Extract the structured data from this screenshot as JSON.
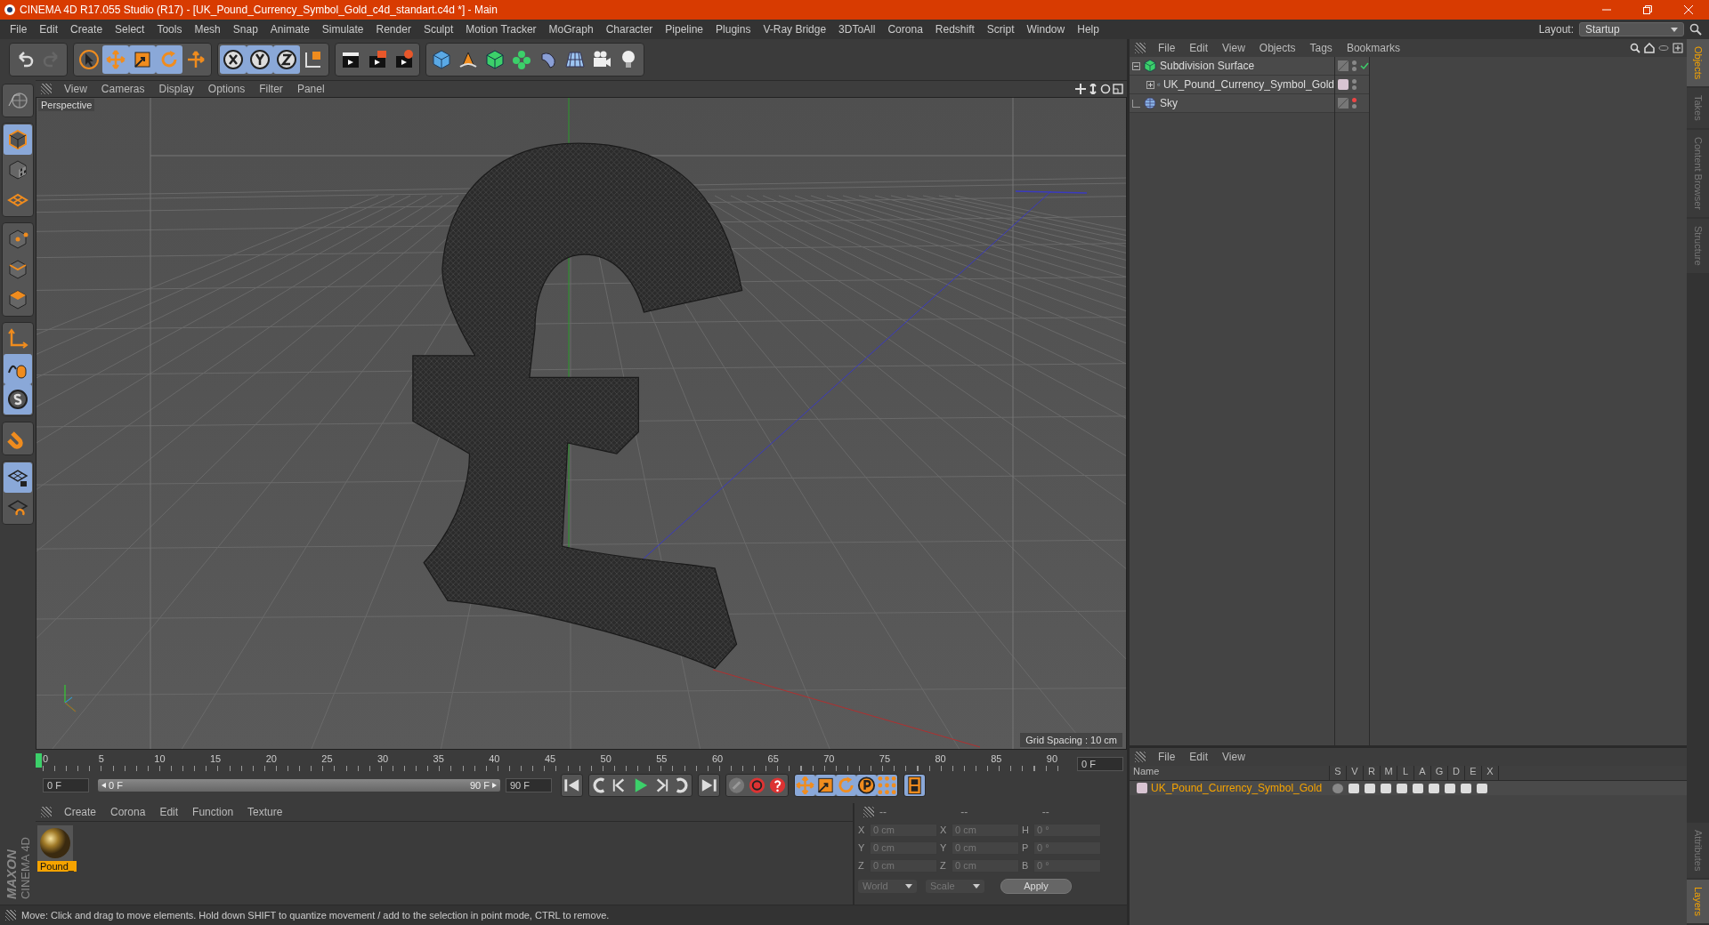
{
  "window": {
    "title": "CINEMA 4D R17.055 Studio (R17) - [UK_Pound_Currency_Symbol_Gold_c4d_standart.c4d *] - Main"
  },
  "menu_bar": [
    "File",
    "Edit",
    "Create",
    "Select",
    "Tools",
    "Mesh",
    "Snap",
    "Animate",
    "Simulate",
    "Render",
    "Sculpt",
    "Motion Tracker",
    "MoGraph",
    "Character",
    "Pipeline",
    "Plugins",
    "V-Ray Bridge",
    "3DToAll",
    "Corona",
    "Redshift",
    "Script",
    "Window",
    "Help"
  ],
  "layout": {
    "label": "Layout:",
    "value": "Startup"
  },
  "toolbar": [
    {
      "items": [
        {
          "kind": "undo",
          "disabled": false
        },
        {
          "kind": "redo",
          "disabled": true
        }
      ]
    },
    {
      "items": [
        {
          "kind": "pointer",
          "selected": false
        },
        {
          "kind": "move",
          "selected": true
        },
        {
          "kind": "scale",
          "selected": true
        },
        {
          "kind": "rotate",
          "selected": true
        },
        {
          "kind": "transform",
          "selected": false
        }
      ]
    },
    {
      "items": [
        {
          "kind": "x",
          "selected": true
        },
        {
          "kind": "y",
          "selected": true
        },
        {
          "kind": "z",
          "selected": true
        },
        {
          "kind": "coords",
          "selected": false
        }
      ]
    },
    {
      "items": [
        {
          "kind": "render-view",
          "selected": false
        },
        {
          "kind": "render-picture",
          "selected": false
        },
        {
          "kind": "render-settings",
          "selected": false
        }
      ]
    },
    {
      "items": [
        {
          "kind": "cube",
          "selected": false
        },
        {
          "kind": "pen",
          "selected": false
        },
        {
          "kind": "subdiv",
          "selected": false
        },
        {
          "kind": "cloner",
          "selected": false
        },
        {
          "kind": "deformer",
          "selected": false
        },
        {
          "kind": "floor",
          "selected": false
        },
        {
          "kind": "camera",
          "selected": false
        },
        {
          "kind": "light",
          "selected": false
        }
      ]
    }
  ],
  "left_toolbar": [
    {
      "items": [
        {
          "kind": "globe",
          "selected": false
        }
      ]
    },
    {
      "items": [
        {
          "kind": "model",
          "selected": true
        },
        {
          "kind": "texture",
          "selected": false
        },
        {
          "kind": "workplane",
          "selected": false
        }
      ]
    },
    {
      "items": [
        {
          "kind": "points",
          "selected": false
        },
        {
          "kind": "edges",
          "selected": false
        },
        {
          "kind": "polygons",
          "selected": false
        }
      ]
    },
    {
      "items": [
        {
          "kind": "axis",
          "selected": false
        },
        {
          "kind": "tweak",
          "selected": true
        },
        {
          "kind": "snap",
          "selected": true
        }
      ]
    },
    {
      "items": [
        {
          "kind": "magnet",
          "selected": false
        }
      ]
    },
    {
      "items": [
        {
          "kind": "gridlock",
          "selected": true
        },
        {
          "kind": "gridrot",
          "selected": false
        }
      ]
    }
  ],
  "logo": {
    "line_1": "MAXON",
    "line_2": "CINEMA 4D"
  },
  "viewport": {
    "menu": [
      "View",
      "Cameras",
      "Display",
      "Options",
      "Filter",
      "Panel"
    ],
    "camera_label": "Perspective",
    "grid_spacing": "Grid Spacing : 10 cm"
  },
  "timeline": {
    "ticks": [
      "0",
      "5",
      "10",
      "15",
      "20",
      "25",
      "30",
      "35",
      "40",
      "45",
      "50",
      "55",
      "60",
      "65",
      "70",
      "75",
      "80",
      "85",
      "90"
    ],
    "playhead": {
      "level": 0
    },
    "current_frame": "0 F",
    "start": "0 F",
    "range": {
      "level": 1
    },
    "range_start": "0 F",
    "range_end": "90 F",
    "end": "90 F",
    "controls": [
      {
        "kind": "first",
        "selected": false
      },
      {
        "kind": "prevkey",
        "selected": false
      },
      {
        "kind": "prevframe",
        "selected": false
      },
      {
        "kind": "play",
        "selected": false
      },
      {
        "kind": "nextframe",
        "selected": false
      },
      {
        "kind": "nextkey",
        "selected": false
      },
      {
        "kind": "last",
        "selected": false
      },
      {
        "kind": "keyoff",
        "selected": false
      },
      {
        "kind": "record",
        "selected": false
      },
      {
        "kind": "autokey",
        "selected": false
      },
      {
        "kind": "move",
        "selected": true
      },
      {
        "kind": "scale",
        "selected": true
      },
      {
        "kind": "rotate",
        "selected": true
      },
      {
        "kind": "param",
        "selected": true
      },
      {
        "kind": "dots",
        "selected": true
      },
      {
        "kind": "film",
        "selected": true
      }
    ]
  },
  "material_manager": {
    "menu": [
      "Create",
      "Corona",
      "Edit",
      "Function",
      "Texture"
    ],
    "materials": [
      {
        "name": "Pound_",
        "selected": true
      }
    ]
  },
  "coordinates": {
    "headers": [
      "--",
      "--",
      "--"
    ],
    "rows": [
      {
        "axis": "X",
        "position": "0 cm",
        "size_axis": "X",
        "size": "0 cm",
        "rotation_axis": "H",
        "rotation": "0 °"
      },
      {
        "axis": "Y",
        "position": "0 cm",
        "size_axis": "Y",
        "size": "0 cm",
        "rotation_axis": "P",
        "rotation": "0 °"
      },
      {
        "axis": "Z",
        "position": "0 cm",
        "size_axis": "Z",
        "size": "0 cm",
        "rotation_axis": "B",
        "rotation": "0 °"
      }
    ],
    "mode": "World",
    "scale_mode": "Scale",
    "apply": "Apply"
  },
  "status_bar": "Move: Click and drag to move elements. Hold down SHIFT to quantize movement / add to the selection in point mode, CTRL to remove.",
  "object_manager": {
    "menu": [
      "File",
      "Edit",
      "View",
      "Objects",
      "Tags",
      "Bookmarks"
    ],
    "objects": [
      {
        "name": "Subdivision Surface",
        "kind": "subdiv",
        "expanded": true,
        "checked": true,
        "editor_visible": true,
        "children": [
          {
            "name": "UK_Pound_Currency_Symbol_Gold",
            "kind": "null",
            "expanded": false,
            "checked": false,
            "editor_visible": true,
            "color": "#d8c4d2"
          }
        ]
      },
      {
        "name": "Sky",
        "kind": "sky",
        "expanded": false,
        "checked": false,
        "editor_visible": false
      }
    ]
  },
  "layer_manager": {
    "menu": [
      "File",
      "Edit",
      "View"
    ],
    "columns": [
      "Name",
      "S",
      "V",
      "R",
      "M",
      "L",
      "A",
      "G",
      "D",
      "E",
      "X"
    ],
    "layers": [
      {
        "name": "UK_Pound_Currency_Symbol_Gold",
        "color": "#d8c4d2"
      }
    ]
  },
  "side_tabs_top": [
    {
      "label": "Objects",
      "selected": true
    },
    {
      "label": "Takes",
      "selected": false
    },
    {
      "label": "Content Browser",
      "selected": false
    },
    {
      "label": "Structure",
      "selected": false
    }
  ],
  "side_tabs_bottom": [
    {
      "label": "Attributes",
      "selected": false
    },
    {
      "label": "Layers",
      "selected": true
    }
  ]
}
